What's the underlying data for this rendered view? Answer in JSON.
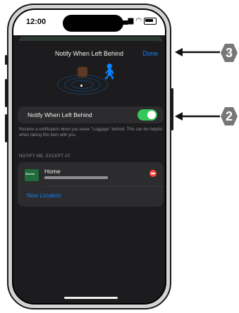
{
  "status_bar": {
    "time": "12:00"
  },
  "sheet": {
    "title": "Notify When Left Behind",
    "done_label": "Done"
  },
  "toggle": {
    "label": "Notify When Left Behind",
    "on": true
  },
  "description": "Receive a notification when you leave \"Luggage\" behind. This can be helpful when taking this item with you.",
  "exceptions": {
    "header": "NOTIFY ME, EXCEPT AT:",
    "locations": [
      {
        "name": "Home",
        "map_label": "Shoink"
      }
    ],
    "new_location_label": "New Location"
  },
  "callouts": {
    "first": "3",
    "second": "2"
  },
  "colors": {
    "accent": "#0a84ff",
    "switch_on": "#34c759",
    "remove": "#ff453a",
    "badge": "#777777"
  }
}
